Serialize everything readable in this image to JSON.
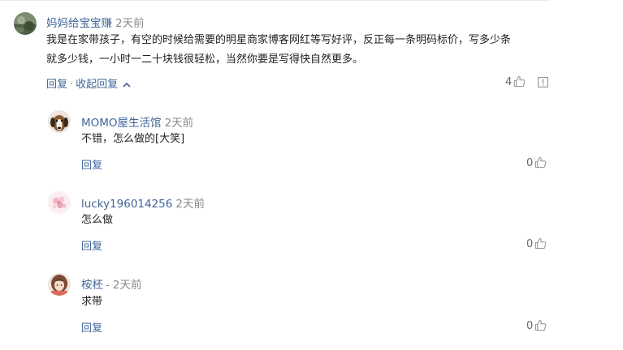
{
  "comments": [
    {
      "username": "妈妈给宝宝赚",
      "time": "2天前",
      "text_lines": [
        "我是在家带孩子，有空的时候给需要的明星商家博客网红等写好评，反正每一条明码标价，写多少条",
        "就多少钱，一小时一二十块钱很轻松，当然你要是写得快自然更多。"
      ],
      "reply_label": "回复",
      "collapse_label": "收起回复",
      "likes": "4",
      "avatar_icon": "landscape-avatar-icon"
    }
  ],
  "replies": [
    {
      "username": "MOMO屋生活馆",
      "separator": "",
      "time": "2天前",
      "text": "不错，怎么做的[大笑]",
      "reply_label": "回复",
      "likes": "0",
      "avatar_icon": "dog-avatar-icon"
    },
    {
      "username": "lucky196014256",
      "separator": "",
      "time": "2天前",
      "text": "怎么做",
      "reply_label": "回复",
      "likes": "0",
      "avatar_icon": "flower-avatar-icon"
    },
    {
      "username": "桉柸",
      "separator": "-",
      "time": "2天前",
      "text": "求带",
      "reply_label": "回复",
      "likes": "0",
      "avatar_icon": "girl-avatar-icon"
    }
  ],
  "colors": {
    "link": "#406599",
    "meta": "#8a8a8a",
    "text": "#222222"
  }
}
